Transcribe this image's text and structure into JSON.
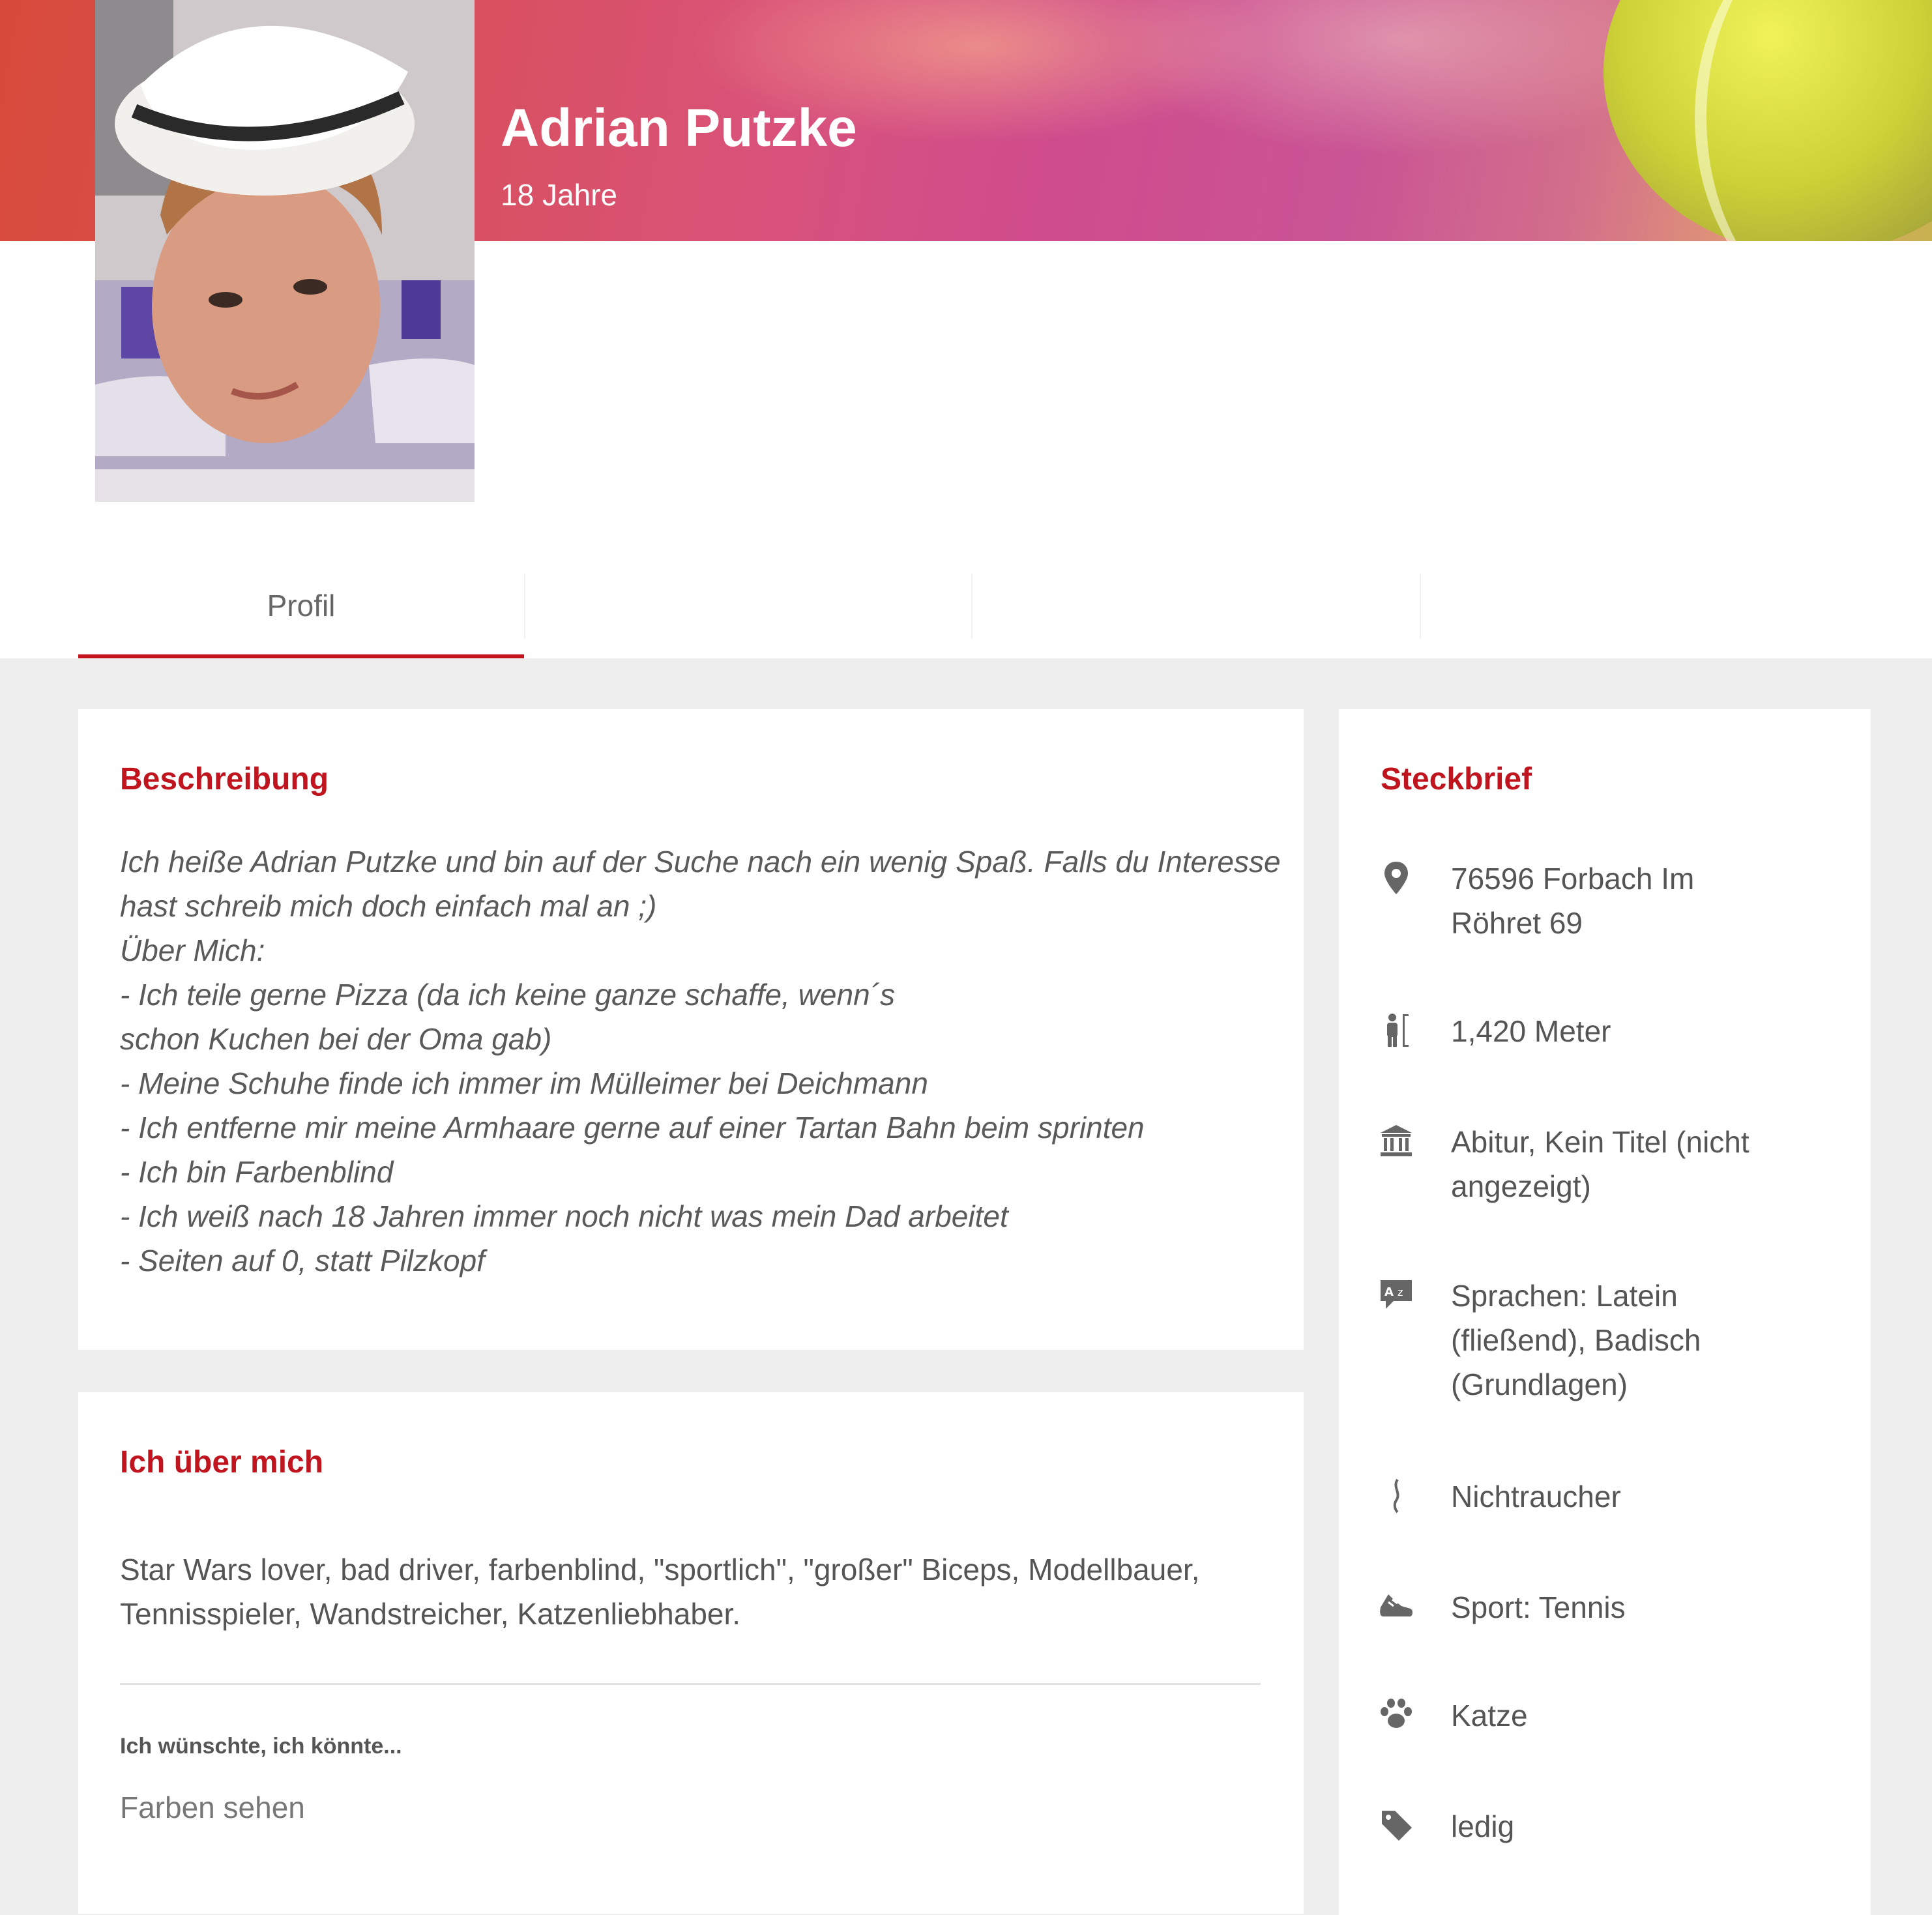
{
  "profile": {
    "name": "Adrian Putzke",
    "age": "18 Jahre"
  },
  "tabs": [
    {
      "label": "Profil",
      "active": true
    },
    {
      "label": ""
    },
    {
      "label": ""
    },
    {
      "label": ""
    }
  ],
  "description": {
    "title": "Beschreibung",
    "lines": [
      "Ich heiße Adrian Putzke und bin auf der Suche nach ein wenig Spaß. Falls du Interesse",
      "hast schreib mich doch einfach mal an ;)",
      "Über Mich:",
      "- Ich teile gerne Pizza (da ich keine ganze schaffe, wenn´s",
      "schon Kuchen bei der Oma gab)",
      "- Meine Schuhe finde ich immer im Mülleimer bei Deichmann",
      "- Ich entferne mir meine Armhaare gerne auf einer Tartan Bahn beim sprinten",
      "- Ich bin Farbenblind",
      "- Ich weiß nach 18 Jahren immer noch nicht was mein Dad arbeitet",
      "- Seiten auf 0, statt Pilzkopf"
    ]
  },
  "about": {
    "title": "Ich über mich",
    "text": "Star Wars lover, bad driver, farbenblind, \"sportlich\", \"großer\" Biceps, Modellbauer, Tennisspieler, Wandstreicher, Katzenliebhaber.",
    "wish_label": "Ich wünschte, ich könnte...",
    "wish_value": "Farben sehen"
  },
  "steckbrief": {
    "title": "Steckbrief",
    "items": [
      {
        "icon": "location-pin-icon",
        "text": "76596 Forbach Im Röhret 69"
      },
      {
        "icon": "height-icon",
        "text": "1,420 Meter"
      },
      {
        "icon": "education-icon",
        "text": "Abitur, Kein Titel (nicht angezeigt)"
      },
      {
        "icon": "language-icon",
        "text": "Sprachen: Latein (fließend), Badisch (Grundlagen)"
      },
      {
        "icon": "smoking-icon",
        "text": "Nichtraucher"
      },
      {
        "icon": "sport-shoe-icon",
        "text": "Sport: Tennis"
      },
      {
        "icon": "paw-icon",
        "text": "Katze"
      },
      {
        "icon": "tag-icon",
        "text": "ledig"
      }
    ]
  },
  "colors": {
    "accent": "#c0151f",
    "background": "#efeeee",
    "card": "#ffffff"
  }
}
